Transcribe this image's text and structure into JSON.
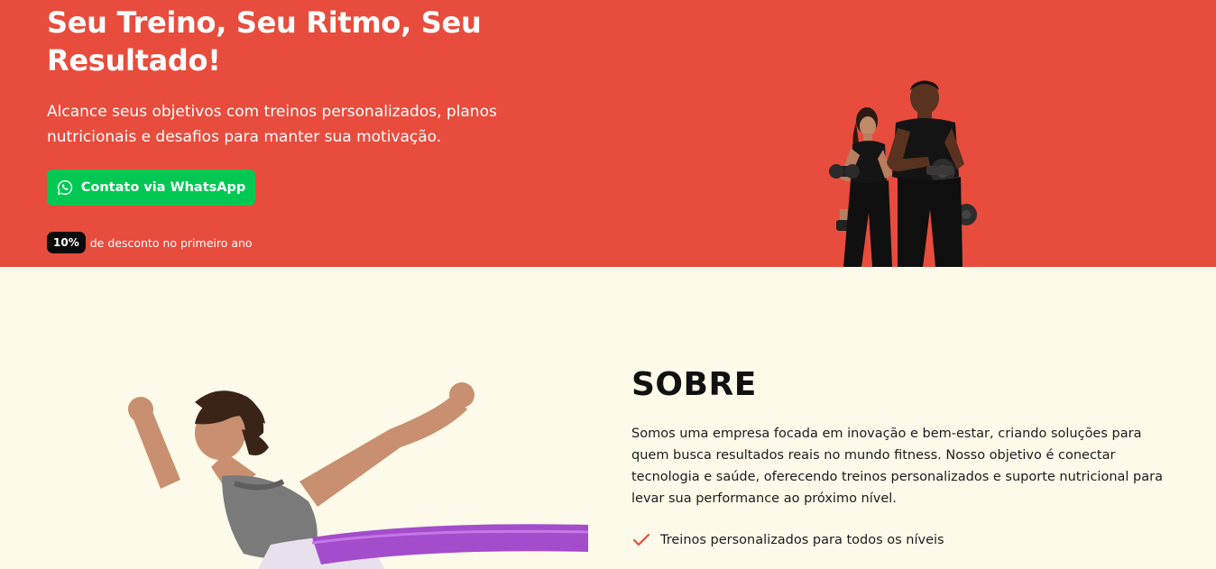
{
  "hero": {
    "title": "Seu Treino, Seu Ritmo, Seu Resultado!",
    "subtitle": "Alcance seus objetivos com treinos personalizados, planos nutricionais e desafios para manter sua motivação.",
    "cta_label": "Contato via WhatsApp",
    "cta_icon": "whatsapp-icon",
    "discount_badge": "10%",
    "discount_text": "de desconto no primeiro ano",
    "background_color": "#e84c3d",
    "cta_color": "#00c853"
  },
  "about": {
    "title": "SOBRE",
    "text": "Somos uma empresa focada em inovação e bem-estar, criando soluções para quem busca resultados reais no mundo fitness. Nosso objetivo é conectar tecnologia e saúde, oferecendo treinos personalizados e suporte nutricional para levar sua performance ao próximo nível.",
    "features": [
      {
        "label": "Treinos personalizados para todos os níveis",
        "icon": "check-icon"
      }
    ],
    "background_color": "#fdfae9",
    "check_color": "#e84c3d"
  }
}
